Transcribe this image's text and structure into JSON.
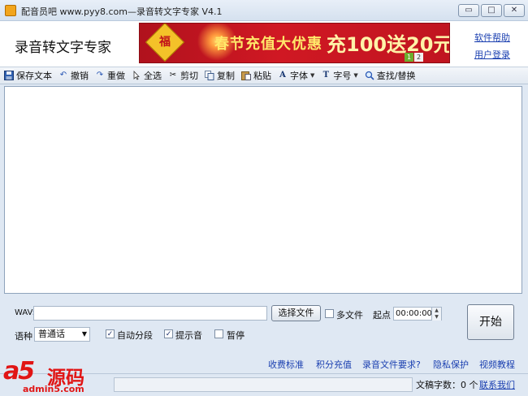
{
  "window": {
    "title": "配音员吧 www.pyy8.com—录音转文字专家 V4.1",
    "minimize_glyph": "▭",
    "maximize_glyph": "□",
    "close_glyph": "✕"
  },
  "header": {
    "app_name": "录音转文字专家",
    "banner": {
      "fu_char": "福",
      "headline": "春节充值大优惠",
      "offer": "充100送20元",
      "pages": [
        "1",
        "2"
      ]
    },
    "links": [
      "软件帮助",
      "用户登录"
    ]
  },
  "toolbar": {
    "items": [
      {
        "label": "保存文本",
        "icon": "save-icon"
      },
      {
        "label": "撤销",
        "icon": "undo-icon"
      },
      {
        "label": "重做",
        "icon": "redo-icon"
      },
      {
        "label": "全选",
        "icon": "cursor-icon"
      },
      {
        "label": "剪切",
        "icon": "scissors-icon"
      },
      {
        "label": "复制",
        "icon": "copy-icon"
      },
      {
        "label": "粘贴",
        "icon": "paste-icon"
      },
      {
        "label": "字体",
        "icon": "font-icon",
        "dropdown": true
      },
      {
        "label": "字号",
        "icon": "font-size-icon",
        "dropdown": true
      },
      {
        "label": "查找/替换",
        "icon": "search-icon"
      }
    ]
  },
  "editor": {
    "content": ""
  },
  "controls": {
    "wav_label": "WAV:",
    "wav_value": "",
    "choose_file_label": "选择文件",
    "multi_file_label": "多文件",
    "multi_file_checked": false,
    "start_point_label": "起点",
    "start_time": "00:00:00",
    "language_label": "语种",
    "language_value": "普通话",
    "auto_segment_label": "自动分段",
    "auto_segment_checked": true,
    "prompt_sound_label": "提示音",
    "prompt_sound_checked": true,
    "pause_label": "暂停",
    "pause_checked": false,
    "start_button_label": "开始"
  },
  "bottom_links": [
    "收费标准",
    "积分充值",
    "录音文件要求?",
    "隐私保护",
    "视频教程"
  ],
  "status": {
    "word_count": "文稿字数：0 个",
    "contact": "联系我们"
  },
  "watermark": {
    "logo": "a5",
    "text": "源码",
    "url": "admin5.com"
  }
}
